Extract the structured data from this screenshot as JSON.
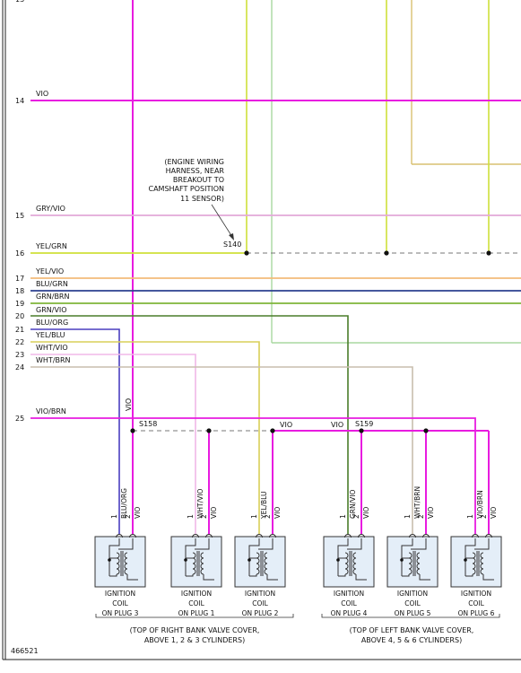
{
  "diagram_id": "466521",
  "colors": {
    "vio": "#e81be0",
    "gry_vio": "#e2a8d8",
    "yel_grn": "#cfe03a",
    "yel_vio": "#f2bb7a",
    "blu_grn": "#2b3f8f",
    "grn_brn": "#7fb43a",
    "grn_vio": "#4a7d2a",
    "blu_org": "#4a3fbf",
    "yel_blu": "#d8cf58",
    "wht_vio": "#f0b8e8",
    "wht_brn": "#c8beae",
    "vio_brn": "#e81be0",
    "light_green": "#a8d8a0",
    "tan": "#d8c070",
    "coil_fill": "#e4eef8",
    "line_gray": "#666666"
  },
  "rows": [
    {
      "num": "13",
      "label": ""
    },
    {
      "num": "14",
      "label": "VIO"
    },
    {
      "num": "15",
      "label": "GRY/VIO"
    },
    {
      "num": "16",
      "label": "YEL/GRN"
    },
    {
      "num": "17",
      "label": "YEL/VIO"
    },
    {
      "num": "18",
      "label": "BLU/GRN"
    },
    {
      "num": "19",
      "label": "GRN/BRN"
    },
    {
      "num": "20",
      "label": "GRN/VIO"
    },
    {
      "num": "21",
      "label": "BLU/ORG"
    },
    {
      "num": "22",
      "label": "YEL/BLU"
    },
    {
      "num": "23",
      "label": "WHT/VIO"
    },
    {
      "num": "24",
      "label": "WHT/BRN"
    },
    {
      "num": "25",
      "label": "VIO/BRN"
    }
  ],
  "note": {
    "lines": [
      "(ENGINE WIRING",
      "HARNESS, NEAR",
      "BREAKOUT TO",
      "CAMSHAFT POSITION",
      "11 SENSOR)"
    ]
  },
  "splices": {
    "s140": "S140",
    "s158": "S158",
    "s159": "S159"
  },
  "wire_labels": {
    "vio_vertical": "VIO",
    "vio_a": "VIO",
    "vio_b": "VIO"
  },
  "coils": [
    {
      "pin1_wire": "BLU/ORG",
      "pin2_wire": "VIO",
      "pin1": "1",
      "pin2": "2",
      "label": [
        "IGNITION",
        "COIL",
        "ON PLUG 3"
      ]
    },
    {
      "pin1_wire": "WHT/VIO",
      "pin2_wire": "VIO",
      "pin1": "1",
      "pin2": "2",
      "label": [
        "IGNITION",
        "COIL",
        "ON PLUG 1"
      ]
    },
    {
      "pin1_wire": "YEL/BLU",
      "pin2_wire": "VIO",
      "pin1": "1",
      "pin2": "2",
      "label": [
        "IGNITION",
        "COIL",
        "ON PLUG 2"
      ]
    },
    {
      "pin1_wire": "GRN/VIO",
      "pin2_wire": "VIO",
      "pin1": "1",
      "pin2": "2",
      "label": [
        "IGNITION",
        "COIL",
        "ON PLUG 4"
      ]
    },
    {
      "pin1_wire": "WHT/BRN",
      "pin2_wire": "VIO",
      "pin1": "1",
      "pin2": "2",
      "label": [
        "IGNITION",
        "COIL",
        "ON PLUG 5"
      ]
    },
    {
      "pin1_wire": "VIO/BRN",
      "pin2_wire": "VIO",
      "pin1": "1",
      "pin2": "2",
      "label": [
        "IGNITION",
        "COIL",
        "ON PLUG 6"
      ]
    }
  ],
  "groups": {
    "right": [
      "(TOP OF RIGHT BANK VALVE COVER,",
      "ABOVE 1, 2 & 3 CYLINDERS)"
    ],
    "left": [
      "(TOP OF LEFT BANK VALVE COVER,",
      "ABOVE 4, 5 & 6 CYLINDERS)"
    ]
  }
}
